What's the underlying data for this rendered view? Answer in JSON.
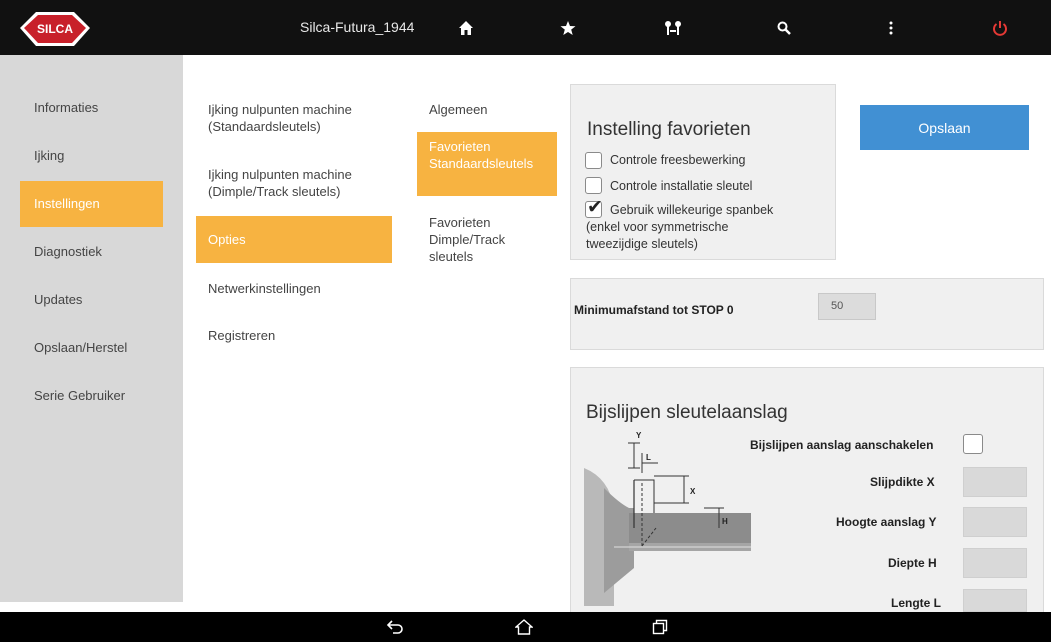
{
  "app": {
    "brand": "SILCA",
    "title": "Silca-Futura_1944"
  },
  "toolbar": {
    "icons": [
      "home-icon",
      "star-icon",
      "tools-icon",
      "search-icon",
      "menu-icon",
      "power-icon"
    ]
  },
  "sidebar": {
    "items": [
      {
        "label": "Informaties",
        "active": false
      },
      {
        "label": "Ijking",
        "active": false
      },
      {
        "label": "Instellingen",
        "active": true
      },
      {
        "label": "Diagnostiek",
        "active": false
      },
      {
        "label": "Updates",
        "active": false
      },
      {
        "label": "Opslaan/Herstel",
        "active": false
      },
      {
        "label": "Serie Gebruiker",
        "active": false
      }
    ]
  },
  "submenu": {
    "items": [
      {
        "line1": "Ijking nulpunten machine",
        "line2": "(Standaardsleutels)"
      },
      {
        "line1": "Ijking nulpunten machine",
        "line2": "(Dimple/Track sleutels)"
      },
      {
        "line1": "Opties",
        "active": true
      },
      {
        "line1": "Netwerkinstellingen"
      },
      {
        "line1": "Registreren"
      }
    ]
  },
  "subsubmenu": {
    "items": [
      {
        "line1": "Algemeen"
      },
      {
        "line1": "Favorieten",
        "line2": "Standaardsleutels",
        "active": true
      },
      {
        "line1": "Favorieten",
        "line2": "Dimple/Track",
        "line3": "sleutels"
      }
    ]
  },
  "favorites": {
    "title": "Instelling favorieten",
    "options": [
      {
        "label": "Controle freesbewerking",
        "checked": false
      },
      {
        "label": "Controle installatie sleutel",
        "checked": false
      },
      {
        "label": "Gebruik willekeurige spanbek",
        "label2": "(enkel voor symmetrische",
        "label3": "tweezijdige sleutels)",
        "checked": true
      }
    ]
  },
  "save_label": "Opslaan",
  "min_distance": {
    "label": "Minimumafstand tot STOP 0",
    "value": "50"
  },
  "grind": {
    "title": "Bijslijpen sleutelaanslag",
    "enable_label": "Bijslijpen aanslag aanschakelen",
    "enabled": false,
    "fields": [
      {
        "label": "Slijpdikte X",
        "value": ""
      },
      {
        "label": "Hoogte aanslag Y",
        "value": ""
      },
      {
        "label": "Diepte H",
        "value": ""
      },
      {
        "label": "Lengte L",
        "value": ""
      }
    ],
    "diagram_labels": {
      "y": "Y",
      "l": "L",
      "x": "X",
      "h": "H"
    }
  },
  "colors": {
    "accent": "#f7b341",
    "button": "#4190d3",
    "topbar": "#111111",
    "sidebar": "#d8d8d8",
    "power": "#e53935"
  },
  "android_nav": [
    "back-icon",
    "home-nav-icon",
    "recents-icon"
  ]
}
